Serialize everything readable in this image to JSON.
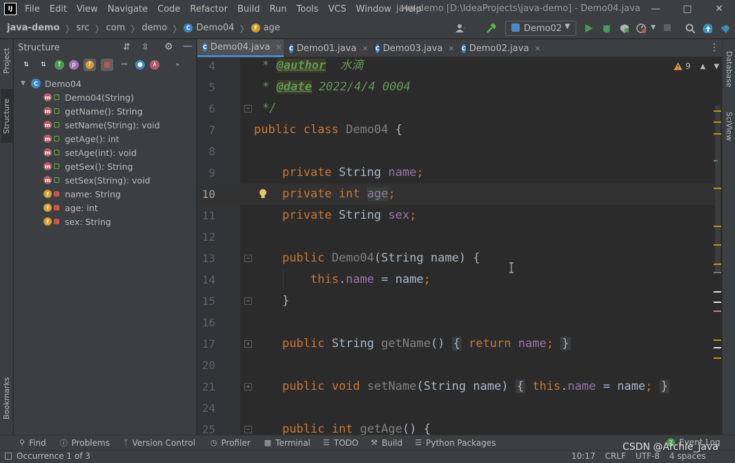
{
  "menubar": {
    "logo": "IJ",
    "items": [
      "File",
      "Edit",
      "View",
      "Navigate",
      "Code",
      "Refactor",
      "Build",
      "Run",
      "Tools",
      "VCS",
      "Window",
      "Help"
    ],
    "window_title": "java-demo [D:\\IdeaProjects\\java-demo] - Demo04.java"
  },
  "breadcrumb": {
    "project": "java-demo",
    "items": [
      "src",
      "com",
      "demo",
      "Demo04",
      "age"
    ]
  },
  "run_config": {
    "label": "Demo02"
  },
  "left_stripe": {
    "project": "Project",
    "structure": "Structure",
    "bookmarks": "Bookmarks"
  },
  "right_stripe": {
    "database": "Database",
    "sciview": "SciView"
  },
  "structure": {
    "title": "Structure",
    "root": "Demo04",
    "members": [
      {
        "kind": "m",
        "vis": "public",
        "label": "Demo04(String)"
      },
      {
        "kind": "m",
        "vis": "public",
        "label": "getName(): String"
      },
      {
        "kind": "m",
        "vis": "public",
        "label": "setName(String): void"
      },
      {
        "kind": "m",
        "vis": "public",
        "label": "getAge(): int"
      },
      {
        "kind": "m",
        "vis": "public",
        "label": "setAge(int): void"
      },
      {
        "kind": "m",
        "vis": "public",
        "label": "getSex(): String"
      },
      {
        "kind": "m",
        "vis": "public",
        "label": "setSex(String): void"
      },
      {
        "kind": "f",
        "vis": "private",
        "label": "name: String"
      },
      {
        "kind": "f",
        "vis": "private",
        "label": "age: int"
      },
      {
        "kind": "f",
        "vis": "private",
        "label": "sex: String"
      }
    ]
  },
  "tabs": [
    {
      "label": "Demo04.java",
      "active": true
    },
    {
      "label": "Demo01.java",
      "active": false
    },
    {
      "label": "Demo03.java",
      "active": false
    },
    {
      "label": "Demo02.java",
      "active": false
    }
  ],
  "editor": {
    "warnings_count": "9",
    "line_numbers": [
      "4",
      "5",
      "6",
      "7",
      "8",
      "9",
      "10",
      "11",
      "12",
      "13",
      "14",
      "15",
      "16",
      "17",
      "20",
      "21",
      "24",
      "25"
    ],
    "current_line": "10",
    "doc_author_tag": "@author",
    "doc_author_value": "水滴",
    "doc_date_tag": "@date",
    "doc_date_value": "2022/4/4 0004",
    "doc_star": "*",
    "doc_end": "*/",
    "kw_public": "public",
    "kw_private": "private",
    "kw_class": "class",
    "kw_int": "int",
    "kw_void": "void",
    "kw_this": "this",
    "kw_return": "return",
    "type_string": "String",
    "class_name": "Demo04",
    "field_name": "name",
    "field_age": "age",
    "field_sex": "sex",
    "param_name": "name",
    "m_getName": "getName",
    "m_setName": "setName",
    "m_getAge": "getAge"
  },
  "bottom_tools": [
    "Find",
    "Problems",
    "Version Control",
    "Profiler",
    "Terminal",
    "TODO",
    "Build",
    "Python Packages"
  ],
  "event_log": {
    "count": "2",
    "label": "Event Log"
  },
  "status": {
    "message": "Occurrence 1 of 3",
    "position": "10:17",
    "line_sep": "CRLF",
    "encoding": "UTF-8",
    "indent": "4 spaces"
  },
  "watermark": "CSDN @Archie_java"
}
